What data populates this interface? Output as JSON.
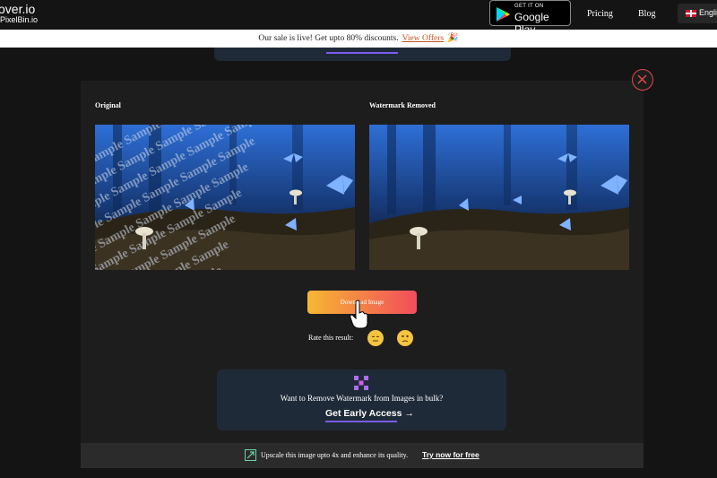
{
  "nav": {
    "brand_name": "over.io",
    "brand_sub": "PixelBin.io",
    "gplay_top": "GET IT ON",
    "gplay_main": "Google Play",
    "pricing": "Pricing",
    "blog": "Blog",
    "language": "English"
  },
  "banner": {
    "text": "Our sale is live! Get upto 80% discounts.",
    "link": "View Offers",
    "icon": "party-popper-icon"
  },
  "modal": {
    "original_label": "Original",
    "removed_label": "Watermark Removed",
    "watermark_text": "Sample",
    "download_label": "Download Image",
    "rate_label": "Rate this result:",
    "bulk_text": "Want to Remove Watermark from Images in bulk?",
    "early_access": "Get Early Access →",
    "upscale_text": "Upscale this image upto 4x and enhance its quality.",
    "upscale_link": "Try now for free"
  },
  "colors": {
    "accent": "#7c5cf0",
    "close": "#e04a4a",
    "btn_start": "#f7b733",
    "btn_end": "#f14d5b"
  }
}
